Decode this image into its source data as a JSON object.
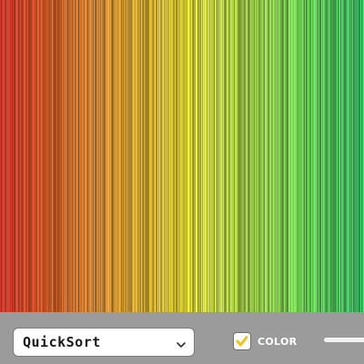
{
  "visualizer": {
    "bar_count": 400,
    "colors": {
      "low": "#d83a2c",
      "mid": "#e8dc3a",
      "high": "#3fd870",
      "background": "#1f1f1f"
    }
  },
  "controls": {
    "algorithm": {
      "selected": "QuickSort",
      "icon": "chevron-down-icon"
    },
    "color_toggle": {
      "label": "COLOR",
      "checked": true,
      "check_color": "#f0c419",
      "icon": "checkmark-icon"
    },
    "speed_slider": {
      "track_color": "#f2f2f2"
    }
  }
}
